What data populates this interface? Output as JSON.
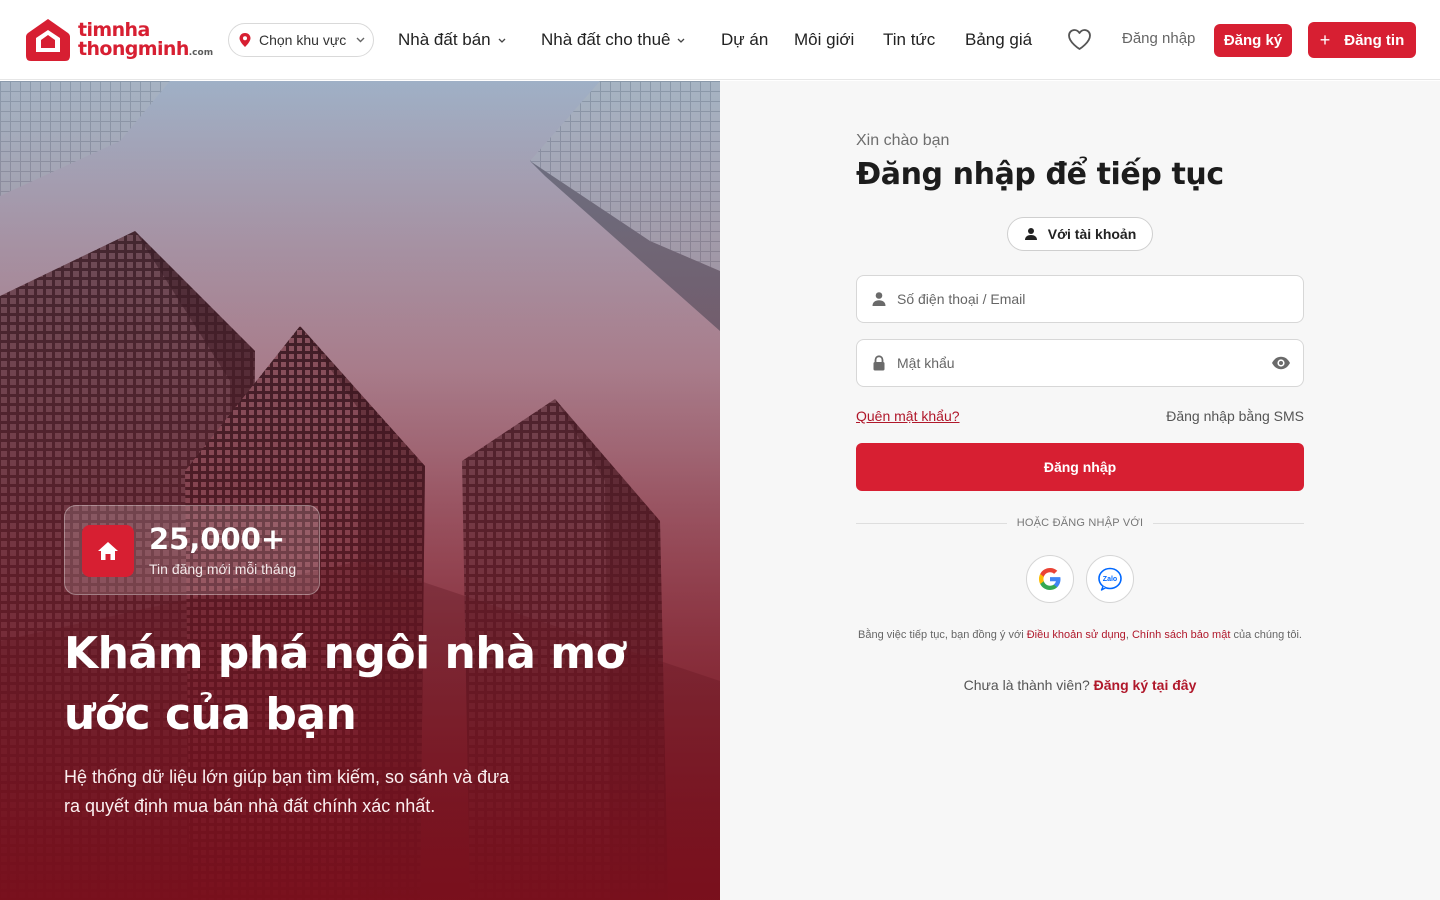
{
  "header": {
    "logo": {
      "line1": "timnha",
      "line2": "thongminh",
      "suffix": ".com"
    },
    "region_select": "Chọn khu vực",
    "nav": [
      {
        "label": "Nhà đất bán",
        "dropdown": true
      },
      {
        "label": "Nhà đất cho thuê",
        "dropdown": true
      },
      {
        "label": "Dự án",
        "dropdown": false
      },
      {
        "label": "Môi giới",
        "dropdown": false
      },
      {
        "label": "Tin tức",
        "dropdown": false
      },
      {
        "label": "Bảng giá",
        "dropdown": false
      }
    ],
    "login_label": "Đăng nhập",
    "register_label": "Đăng ký",
    "post_label": "Đăng tin",
    "icons": {
      "favorites": "heart-icon",
      "region": "map-pin-icon",
      "post": "plus-icon"
    }
  },
  "hero": {
    "stat_value": "25,000+",
    "stat_label": "Tin đăng mới mỗi tháng",
    "title": "Khám phá ngôi nhà mơ ước của bạn",
    "subtitle": "Hệ thống dữ liệu lớn giúp bạn tìm kiếm, so sánh và đưa ra quyết định mua bán nhà đất chính xác nhất.",
    "icon": "home-icon"
  },
  "login": {
    "greeting": "Xin chào bạn",
    "title": "Đăng nhập để tiếp tục",
    "tab_account": "Với tài khoản",
    "phone_placeholder": "Số điện thoại / Email",
    "password_placeholder": "Mật khẩu",
    "forgot": "Quên mật khẩu?",
    "sms": "Đăng nhập bằng SMS",
    "submit": "Đăng nhập",
    "divider": "HOẶC ĐĂNG NHẬP VỚI",
    "social": [
      "google-icon",
      "zalo-icon"
    ],
    "zalo_text": "Zalo",
    "terms_prefix": "Bằng việc tiếp tục, bạn đồng ý với ",
    "terms_link1": "Điều khoản sử dụng",
    "terms_sep": ", ",
    "terms_link2": "Chính sách bảo mật",
    "terms_suffix": " của chúng tôi.",
    "member_prefix": "Chưa là thành viên? ",
    "member_link": "Đăng ký tại đây"
  },
  "colors": {
    "accent": "#d71f32",
    "link": "#b0182b",
    "panel_bg": "#f7f7f7"
  }
}
